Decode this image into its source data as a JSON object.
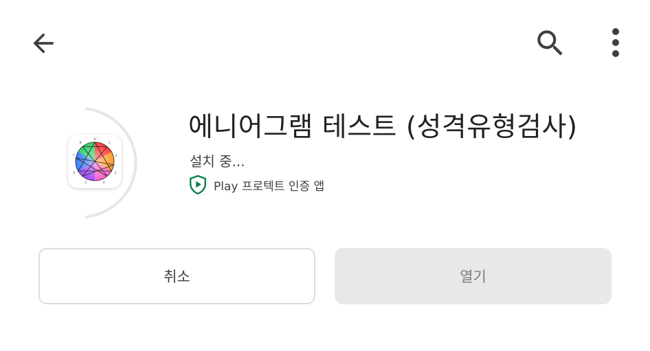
{
  "topbar": {
    "back_icon": "arrow-back-icon",
    "search_icon": "search-icon",
    "more_icon": "more-vert-icon"
  },
  "app": {
    "title": "에니어그램 테스트 (성격유형검사)",
    "status": "설치 중...",
    "protect_label": "Play 프로텍트 인증 앱",
    "icon": "enneagram-app-icon",
    "install_progress": 0.45
  },
  "buttons": {
    "cancel_label": "취소",
    "open_label": "열기"
  },
  "colors": {
    "text_primary": "#202124",
    "text_secondary": "#3c4043",
    "progress_track": "#e6e6e6",
    "protect_green": "#0b8043",
    "disabled_button": "#e8e8e8"
  }
}
